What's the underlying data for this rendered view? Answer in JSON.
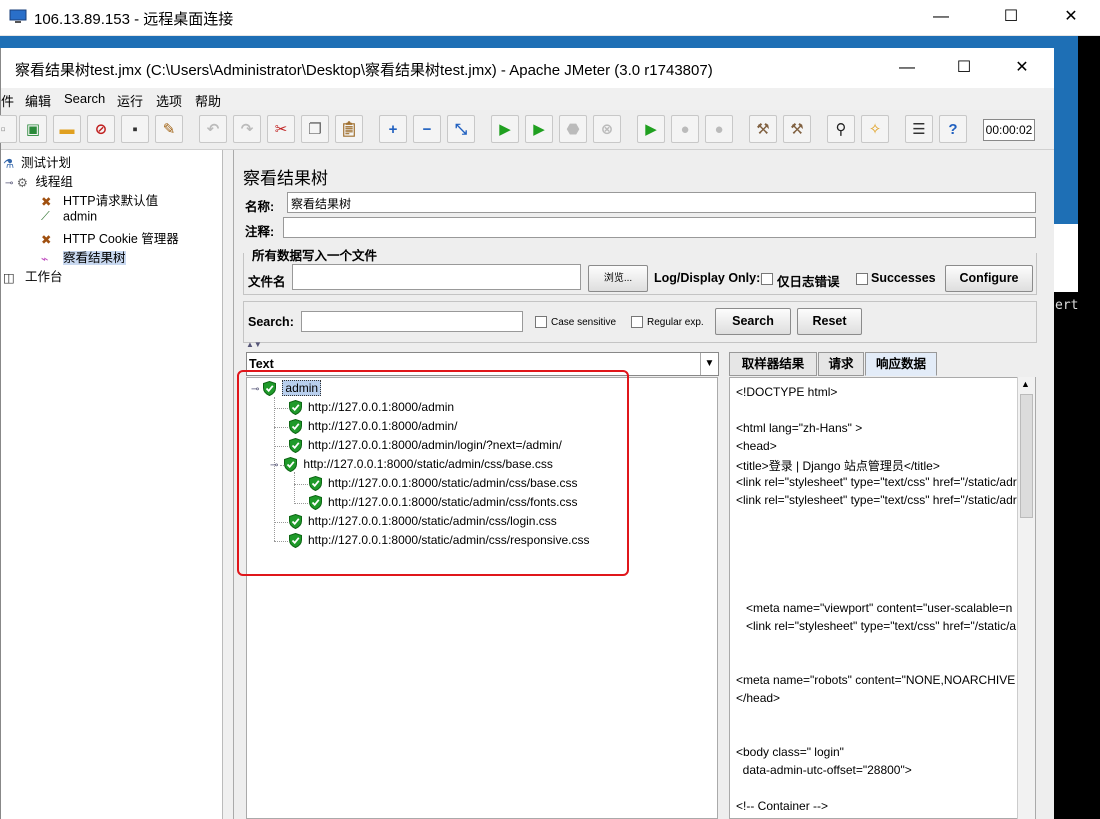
{
  "rdp": {
    "title": "106.13.89.153 - 远程桌面连接",
    "minimize": "—",
    "maximize": "☐",
    "close": "✕"
  },
  "desktop": {
    "term_text": "ert"
  },
  "jmeter": {
    "title": "察看结果树test.jmx (C:\\Users\\Administrator\\Desktop\\察看结果树test.jmx) - Apache JMeter (3.0 r1743807)",
    "menu": [
      "件",
      "编辑",
      "Search",
      "运行",
      "选项",
      "帮助"
    ],
    "timer": "00:00:02"
  },
  "tree": {
    "items": [
      "测试计划",
      "线程组",
      "HTTP请求默认值",
      "admin",
      "HTTP Cookie 管理器",
      "察看结果树",
      "工作台"
    ]
  },
  "panel": {
    "title": "察看结果树",
    "name_label": "名称:",
    "name_value": "察看结果树",
    "comment_label": "注释:",
    "file_group": "所有数据写入一个文件",
    "file_label": "文件名",
    "browse": "浏览...",
    "log_display": "Log/Display Only:",
    "errors_only": "仅日志错误",
    "successes": "Successes",
    "configure": "Configure",
    "search_label": "Search:",
    "case_sensitive": "Case sensitive",
    "regex": "Regular exp.",
    "search_btn": "Search",
    "reset_btn": "Reset",
    "renderer": "Text"
  },
  "results": {
    "root": "admin",
    "items": [
      "http://127.0.0.1:8000/admin",
      "http://127.0.0.1:8000/admin/",
      "http://127.0.0.1:8000/admin/login/?next=/admin/",
      "http://127.0.0.1:8000/static/admin/css/base.css",
      "http://127.0.0.1:8000/static/admin/css/base.css",
      "http://127.0.0.1:8000/static/admin/css/fonts.css",
      "http://127.0.0.1:8000/static/admin/css/login.css",
      "http://127.0.0.1:8000/static/admin/css/responsive.css"
    ]
  },
  "tabs": [
    "取样器结果",
    "请求",
    "响应数据"
  ],
  "response": [
    "<!DOCTYPE html>",
    "<html lang=\"zh-Hans\" >",
    "<head>",
    "<title>登录 | Django 站点管理员</title>",
    "<link rel=\"stylesheet\" type=\"text/css\" href=\"/static/adr",
    "<link rel=\"stylesheet\" type=\"text/css\" href=\"/static/adr",
    "   <meta name=\"viewport\" content=\"user-scalable=n",
    "   <link rel=\"stylesheet\" type=\"text/css\" href=\"/static/a",
    "<meta name=\"robots\" content=\"NONE,NOARCHIVE",
    "</head>",
    "<body class=\" login\"",
    "  data-admin-utc-offset=\"28800\">",
    "<!-- Container -->"
  ]
}
